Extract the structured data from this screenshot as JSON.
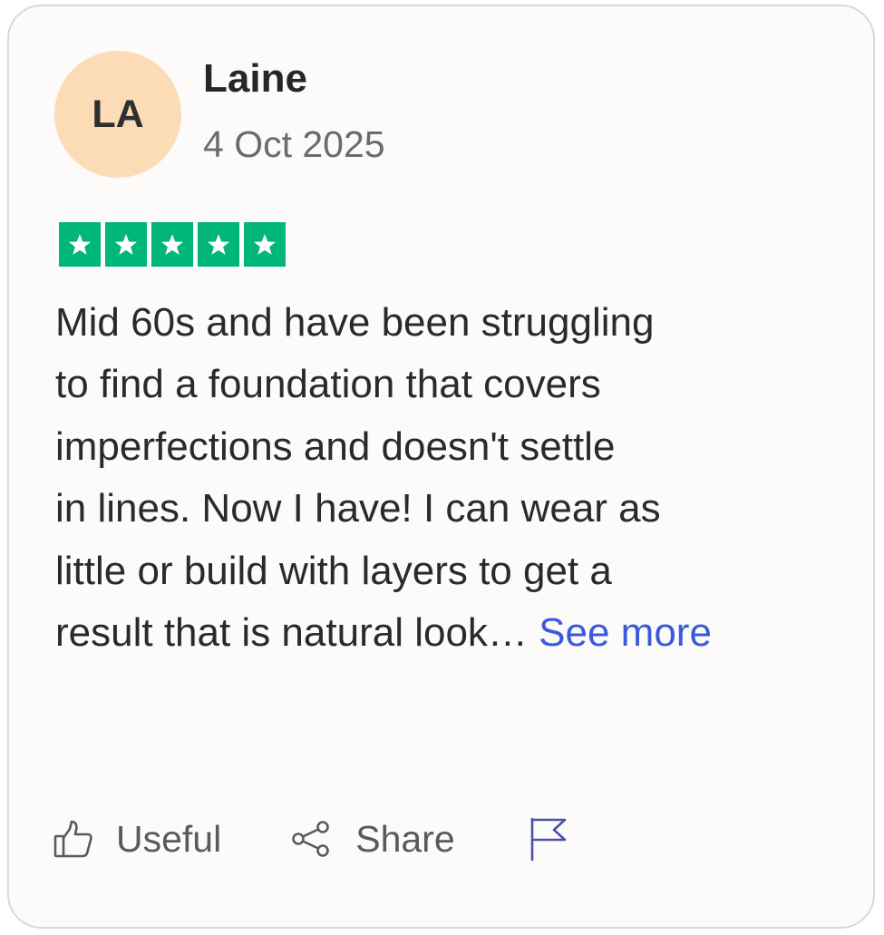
{
  "review": {
    "avatar_initials": "LA",
    "author": "Laine",
    "date": "4 Oct 2025",
    "rating": 5,
    "rating_color": "#00b67a",
    "avatar_color": "#fbdcb7",
    "text_lines": [
      "Mid 60s and have been struggling",
      "to find a foundation that covers",
      "imperfections and doesn't settle",
      "in lines. Now I have! I can wear as",
      "little or build with layers to get a",
      "result that is natural look…"
    ],
    "see_more": "See more",
    "see_more_color": "#3a5bd9"
  },
  "actions": {
    "useful_label": "Useful",
    "useful_icon": "thumbs-up-icon",
    "share_label": "Share",
    "share_icon": "share-icon",
    "report_icon": "flag-icon"
  }
}
